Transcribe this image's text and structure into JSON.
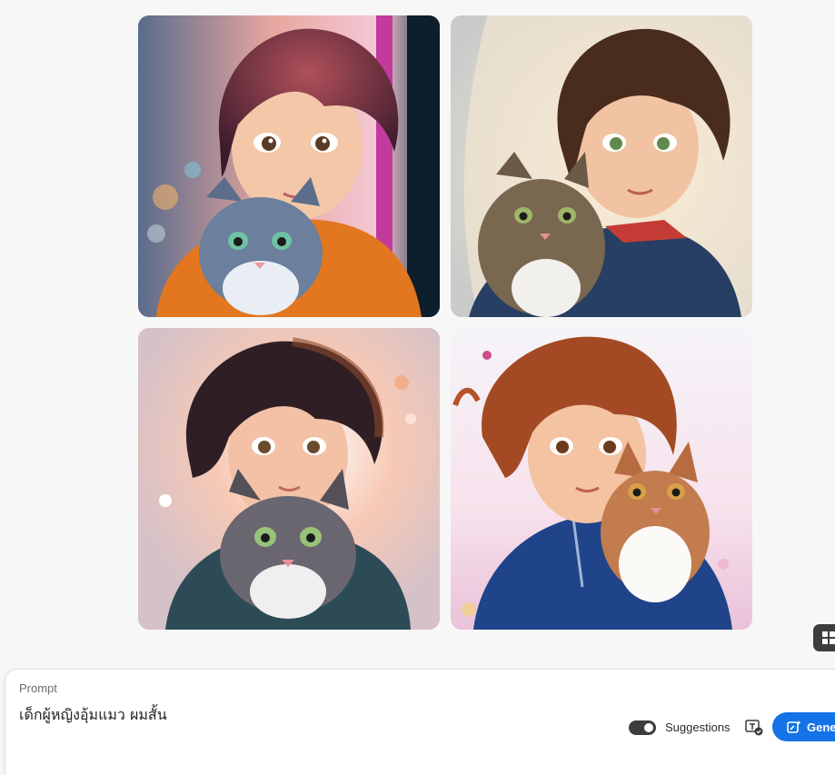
{
  "images": [
    {
      "alt": "girl-with-cat-1"
    },
    {
      "alt": "girl-with-cat-2"
    },
    {
      "alt": "girl-with-cat-3"
    },
    {
      "alt": "girl-with-cat-4"
    }
  ],
  "prompt": {
    "label": "Prompt",
    "value": "เด็กผู้หญิงอุ้มแมว ผมสั้น"
  },
  "controls": {
    "suggestions_label": "Suggestions",
    "suggestions_on": true,
    "generate_label": "Gene"
  },
  "icons": {
    "grid_view": "grid-view-icon",
    "text_credential": "content-credentials-icon",
    "generate": "generate-sparkle-icon"
  },
  "colors": {
    "accent": "#1473e6",
    "toggle": "#3d3d3d",
    "background": "#f7f7f7"
  }
}
